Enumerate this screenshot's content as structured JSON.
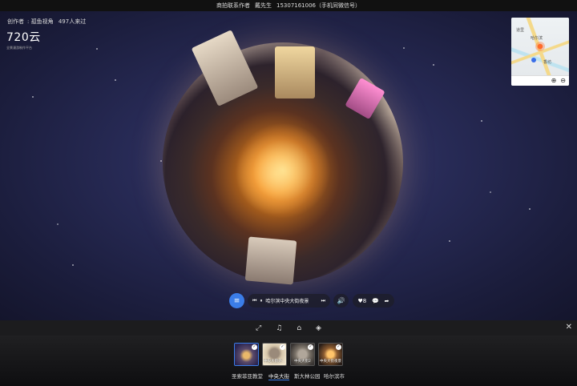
{
  "topbar": {
    "contact_label": "商拍联系作者",
    "contact_name": "戴先生",
    "contact_phone": "15307161006（手机同微信号）"
  },
  "author": {
    "prefix": "创作者",
    "name": "孤鱼视角",
    "visits": "497人来过"
  },
  "logo": {
    "text": "720云",
    "sub": "全景漫游制作平台"
  },
  "minimap": {
    "city_label": "哈尔滨",
    "sub_label_1": "道里",
    "sub_label_2": "香坊",
    "zoom_in": "⊕",
    "zoom_out": "⊖"
  },
  "player": {
    "list_label": "≡",
    "prev": "⏮",
    "pause": "⏸",
    "title": "哈尔滨中央大街夜景",
    "next": "⏭",
    "volume": "🔊",
    "like_count": "8"
  },
  "toolbar": {
    "fullscreen": "⤢",
    "music": "♫",
    "vr": "⌂",
    "gyro": "◈",
    "close": "✕"
  },
  "scenes": [
    {
      "thumb_caption": "",
      "label": "圣索菲亚教堂",
      "active": true,
      "color": "#5a4a6a"
    },
    {
      "thumb_caption": "中央大街外...",
      "label": "中央大街",
      "active": false,
      "color": "#c9b59a"
    },
    {
      "thumb_caption": "中央大街2",
      "label": "斯大林公园",
      "active": false,
      "color": "#8a8070"
    },
    {
      "thumb_caption": "中央大街夜景",
      "label": "哈尔滨市",
      "active": false,
      "color": "#6a4a30"
    }
  ],
  "colors": {
    "accent": "#3b7de8",
    "bar_bg": "#1c1c1e"
  }
}
